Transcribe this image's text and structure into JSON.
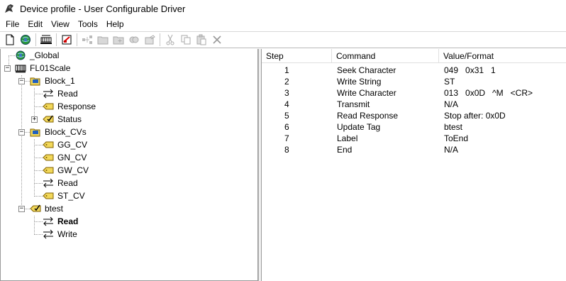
{
  "window": {
    "title": "Device profile - User Configurable Driver"
  },
  "menu": [
    "File",
    "Edit",
    "View",
    "Tools",
    "Help"
  ],
  "toolbar": {
    "buttons": [
      "new-document-icon",
      "globe-icon",
      "device-icon",
      "checklist-icon",
      "connect-icon",
      "folder-icon",
      "folder-add-icon",
      "tag-icon",
      "properties-icon",
      "cut-icon",
      "copy-icon",
      "paste-icon",
      "delete-icon"
    ]
  },
  "tree": {
    "global": "_Global",
    "device": "FL01Scale",
    "block1": {
      "label": "Block_1",
      "read": "Read",
      "response": "Response",
      "status": "Status"
    },
    "blockcvs": {
      "label": "Block_CVs",
      "items": [
        "GG_CV",
        "GN_CV",
        "GW_CV",
        "Read",
        "ST_CV"
      ]
    },
    "btest": {
      "label": "btest",
      "read": "Read",
      "write": "Write"
    }
  },
  "steps_table": {
    "headers": [
      "Step",
      "Command",
      "Value/Format"
    ],
    "rows": [
      {
        "step": "1",
        "command": "Seek Character",
        "value": "049   0x31   1"
      },
      {
        "step": "2",
        "command": "Write String",
        "value": "ST"
      },
      {
        "step": "3",
        "command": "Write Character",
        "value": "013   0x0D   ^M   <CR>"
      },
      {
        "step": "4",
        "command": "Transmit",
        "value": "N/A"
      },
      {
        "step": "5",
        "command": "Read Response",
        "value": "Stop after: 0x0D"
      },
      {
        "step": "6",
        "command": "Update Tag",
        "value": "btest"
      },
      {
        "step": "7",
        "command": "Label",
        "value": "ToEnd"
      },
      {
        "step": "8",
        "command": "End",
        "value": "N/A"
      }
    ]
  }
}
